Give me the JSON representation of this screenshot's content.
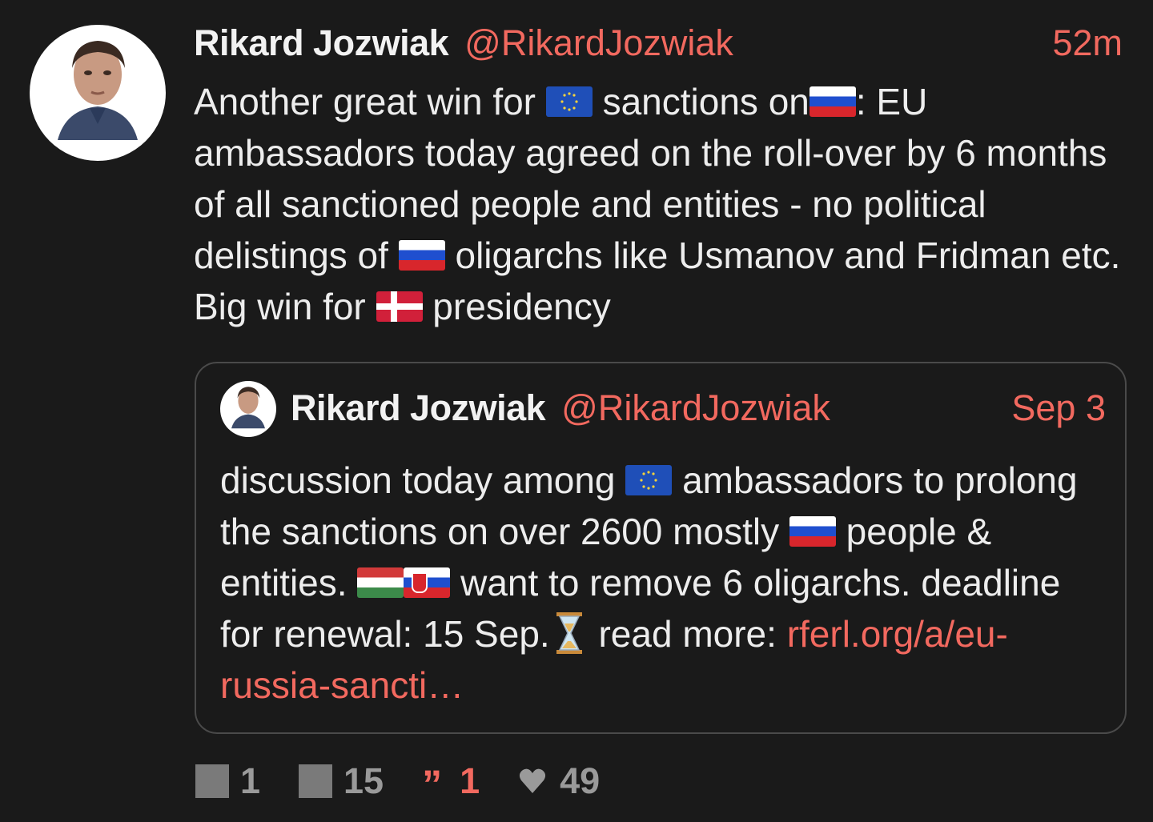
{
  "tweet": {
    "author_name": "Rikard Jozwiak",
    "author_handle": "@RikardJozwiak",
    "timestamp": "52m",
    "text": {
      "p1": "Another great win for ",
      "p2": " sanctions on",
      "p3": ": EU ambassadors today agreed on the roll-over by 6 months of all sanctioned people and entities - no political delistings of ",
      "p4": " oligarchs like Usmanov and Fridman etc. Big win for ",
      "p5": " presidency"
    },
    "flags": [
      "eu-flag-icon",
      "russia-flag-icon",
      "russia-flag-icon",
      "denmark-flag-icon"
    ]
  },
  "quote": {
    "author_name": "Rikard Jozwiak",
    "author_handle": "@RikardJozwiak",
    "timestamp": "Sep 3",
    "text": {
      "p1": "discussion today among ",
      "p2": " ambassadors to prolong the sanctions on over 2600 mostly ",
      "p3": " people & entities. ",
      "p4": " want to remove 6 oligarchs. deadline for renewal: 15 Sep.",
      "p5": " read more: ",
      "link": "rferl.org/a/eu-russia-sancti…"
    },
    "flags": [
      "eu-flag-icon",
      "russia-flag-icon",
      "hungary-flag-icon",
      "slovakia-flag-icon",
      "hourglass-icon"
    ]
  },
  "actions": {
    "reply_count": "1",
    "repost_count": "15",
    "quote_count": "1",
    "like_count": "49"
  },
  "colors": {
    "background": "#1a1a1a",
    "accent": "#f2695f",
    "text": "#ededed",
    "muted": "#9a9a9a"
  }
}
